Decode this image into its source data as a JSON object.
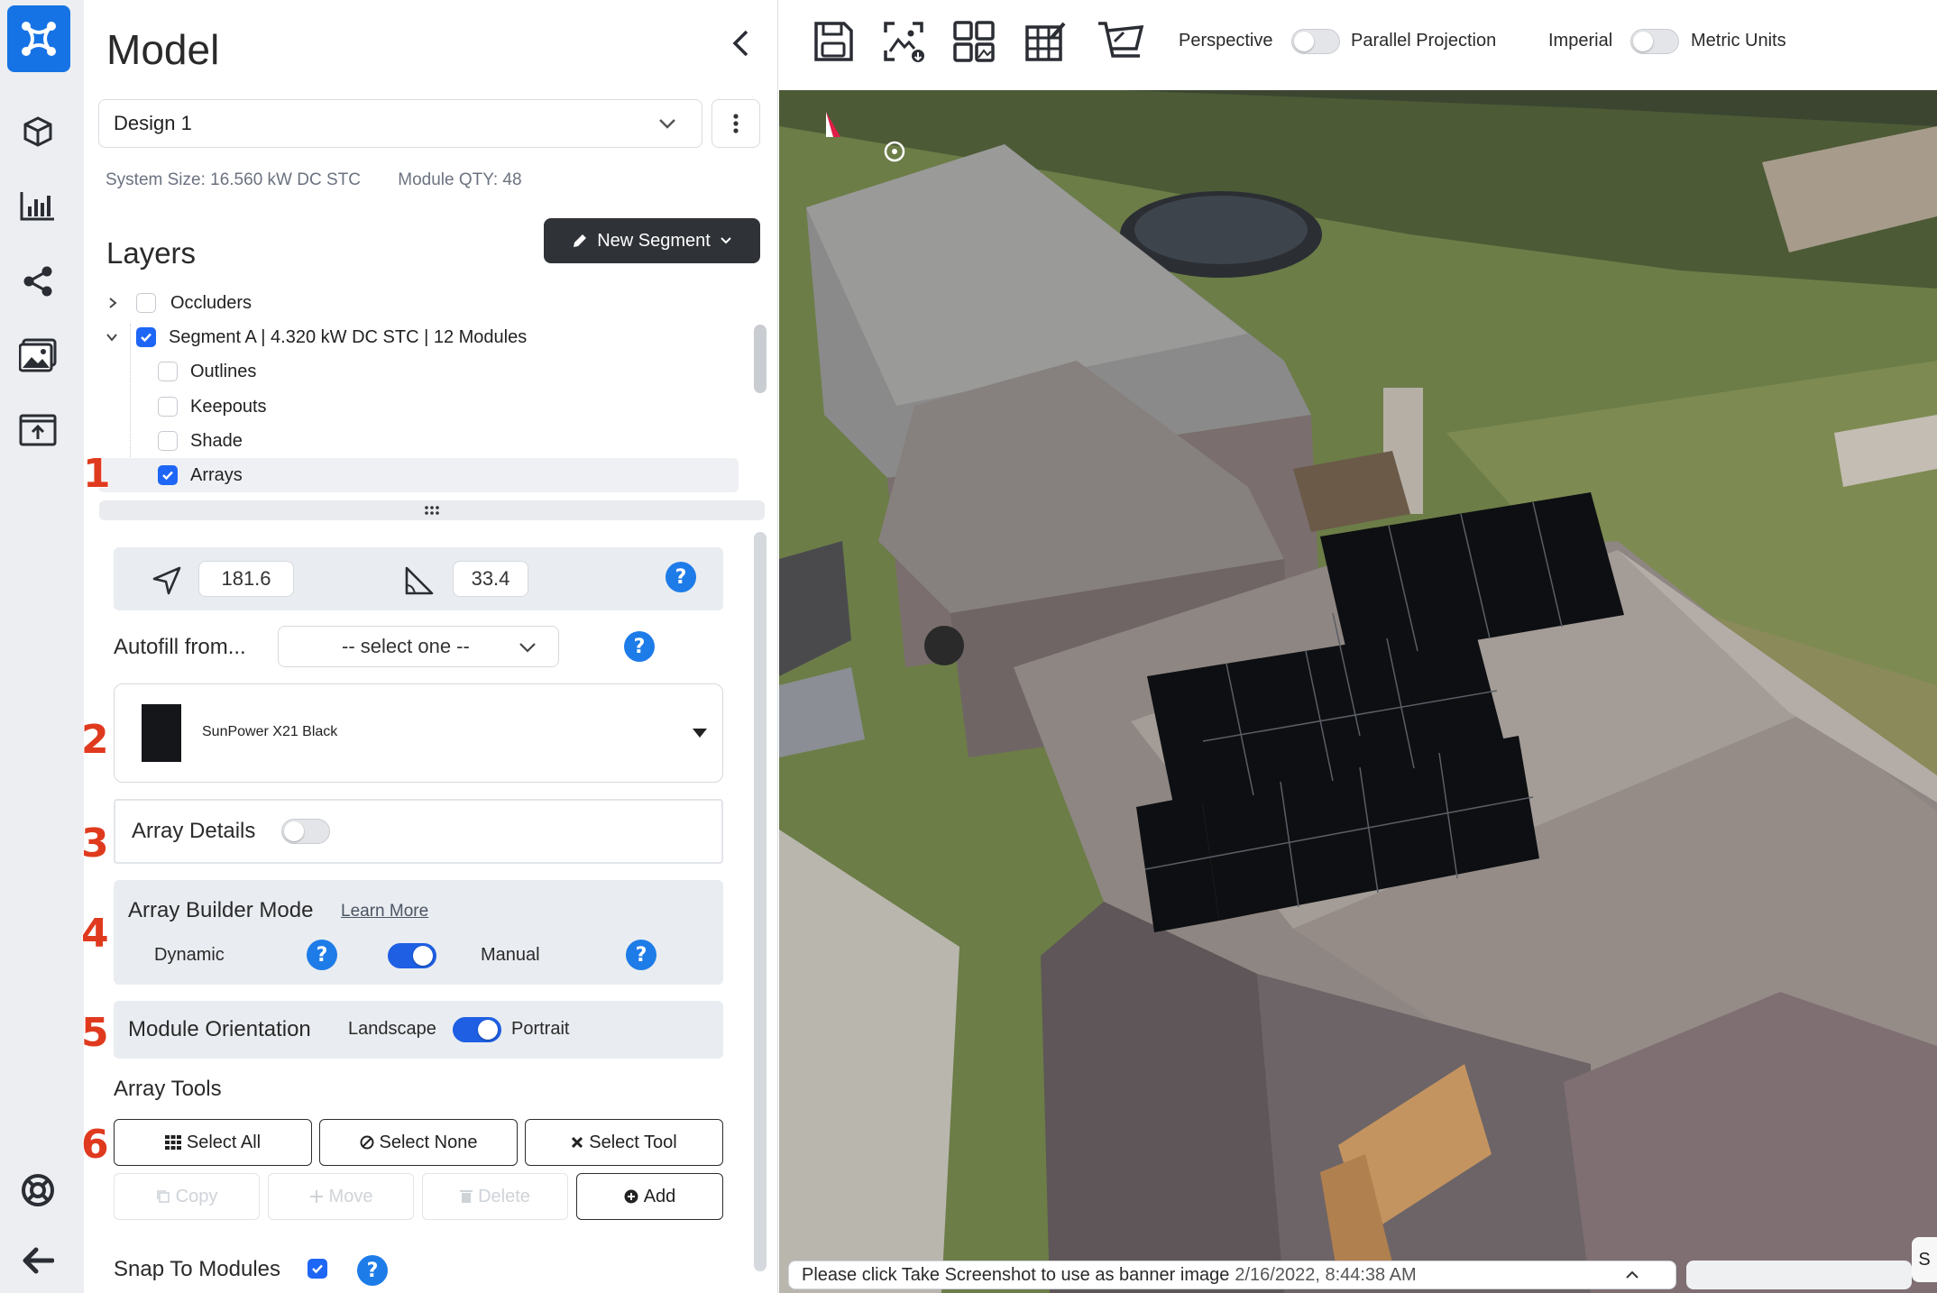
{
  "app": {
    "brand_color": "#1673e6",
    "rail_icons": [
      "logo-icon",
      "cube-icon",
      "bar-chart-icon",
      "share-icon",
      "image-icon",
      "upload-folder-icon",
      "lifebuoy-icon",
      "arrow-left-icon"
    ]
  },
  "sidebar": {
    "title": "Model",
    "design_select": {
      "value": "Design 1"
    },
    "system_size": "System Size: 16.560 kW DC STC",
    "module_qty": "Module QTY: 48",
    "layers_title": "Layers",
    "new_segment_label": "New Segment",
    "tree": [
      {
        "label": "Occluders",
        "checked": false,
        "level": 0,
        "expanded": false
      },
      {
        "label": "Segment A | 4.320 kW DC STC | 12 Modules",
        "checked": true,
        "level": 0,
        "expanded": true
      },
      {
        "label": "Outlines",
        "checked": false,
        "level": 1
      },
      {
        "label": "Keepouts",
        "checked": false,
        "level": 1
      },
      {
        "label": "Shade",
        "checked": false,
        "level": 1
      },
      {
        "label": "Arrays",
        "checked": true,
        "level": 1,
        "selected": true
      }
    ]
  },
  "arrays": {
    "azimuth": "181.6",
    "tilt": "33.4",
    "autofill_label": "Autofill from...",
    "autofill_placeholder": "-- select one --",
    "module_name": "SunPower X21 Black",
    "array_details_label": "Array Details",
    "array_details_on": false,
    "builder_mode_label": "Array Builder Mode",
    "learn_more": "Learn More",
    "dynamic_label": "Dynamic",
    "manual_label": "Manual",
    "builder_manual": true,
    "orientation_label": "Module Orientation",
    "landscape_label": "Landscape",
    "portrait_label": "Portrait",
    "orientation_portrait": true,
    "tools_title": "Array Tools",
    "select_all": "Select All",
    "select_none": "Select None",
    "select_tool": "Select Tool",
    "copy": "Copy",
    "move": "Move",
    "delete": "Delete",
    "add": "Add",
    "snap_label": "Snap To Modules",
    "snap_on": true
  },
  "markers": [
    "1",
    "2",
    "3",
    "4",
    "5",
    "6"
  ],
  "toolbar": {
    "icons": [
      "save-icon",
      "screenshot-icon",
      "layout-icon",
      "grid-edit-icon",
      "cart-icon"
    ],
    "perspective": "Perspective",
    "parallel": "Parallel Projection",
    "imperial": "Imperial",
    "metric": "Metric Units"
  },
  "status": {
    "message": "Please click Take Screenshot to use as banner image",
    "timestamp": "2/16/2022, 8:44:38 AM",
    "side_tab": "S"
  },
  "colors": {
    "accent": "#1e66f5",
    "help": "#1d7ce8",
    "marker": "#e03a1e",
    "dark_button": "#2f3237"
  }
}
